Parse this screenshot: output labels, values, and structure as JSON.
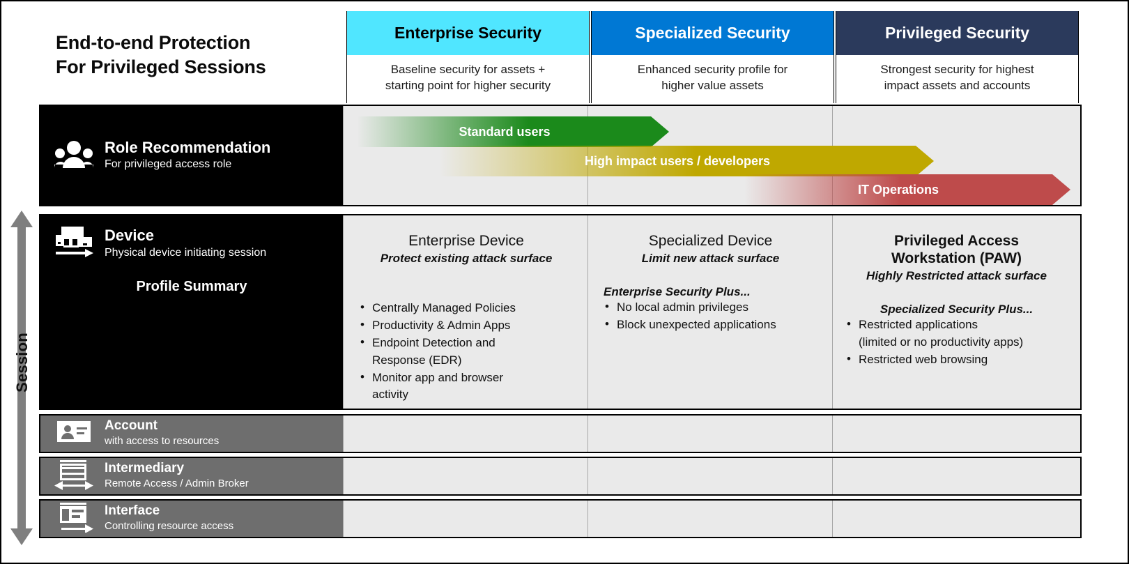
{
  "title": {
    "line1": "End-to-end Protection",
    "line2": "For Privileged Sessions"
  },
  "session_axis": {
    "label": "Session"
  },
  "colors": {
    "enterprise": "#50E6FF",
    "specialized": "#0078D4",
    "privileged": "#2B3A5C",
    "pane": "#eaeaea",
    "row_black": "#000000",
    "row_grey": "#6e6e6e",
    "arrow_green": "#1B8A1B",
    "arrow_gold": "#BFA800",
    "arrow_red": "#BE4B4B"
  },
  "columns": [
    {
      "id": "enterprise",
      "label": "Enterprise Security",
      "description": "Baseline security for assets +\nstarting point for higher security",
      "header_bg": "#50E6FF",
      "header_fg": "#000000"
    },
    {
      "id": "specialized",
      "label": "Specialized Security",
      "description": "Enhanced security profile for\nhigher value assets",
      "header_bg": "#0078D4",
      "header_fg": "#ffffff"
    },
    {
      "id": "privileged",
      "label": "Privileged Security",
      "description": "Strongest security for highest\nimpact assets and accounts",
      "header_bg": "#2B3A5C",
      "header_fg": "#ffffff"
    }
  ],
  "rows": {
    "role": {
      "icon": "people-group-icon",
      "title": "Role Recommendation",
      "subtitle": "For privileged access role",
      "arrows": [
        {
          "label": "Standard users",
          "color": "#1B8A1B"
        },
        {
          "label": "High impact users / developers",
          "color": "#BFA800"
        },
        {
          "label": "IT Operations",
          "color": "#BE4B4B"
        }
      ]
    },
    "device": {
      "icon": "device-monitor-icon",
      "title": "Device",
      "subtitle": "Physical device initiating session",
      "profile_summary": "Profile Summary",
      "cells": [
        {
          "name": "Enterprise Device",
          "name_bold": false,
          "tagline": "Protect existing attack surface",
          "plus_header": "",
          "bullets": [
            "Centrally Managed Policies",
            "Productivity & Admin Apps",
            "Endpoint Detection and\nResponse (EDR)",
            "Monitor app and browser\nactivity"
          ]
        },
        {
          "name": "Specialized Device",
          "name_bold": false,
          "tagline": "Limit new attack surface",
          "plus_header": "Enterprise Security Plus...",
          "bullets": [
            "No local admin privileges",
            "Block unexpected applications"
          ]
        },
        {
          "name": "Privileged Access\nWorkstation (PAW)",
          "name_bold": true,
          "tagline": "Highly Restricted attack surface",
          "plus_header": "Specialized Security Plus...",
          "bullets": [
            "Restricted applications\n(limited or no productivity apps)",
            "Restricted web browsing"
          ]
        }
      ]
    },
    "account": {
      "icon": "id-card-icon",
      "title": "Account",
      "subtitle": "with access to resources"
    },
    "intermediary": {
      "icon": "broker-window-icon",
      "title": "Intermediary",
      "subtitle": "Remote Access / Admin Broker"
    },
    "interface": {
      "icon": "interface-window-icon",
      "title": "Interface",
      "subtitle": "Controlling resource access"
    }
  }
}
